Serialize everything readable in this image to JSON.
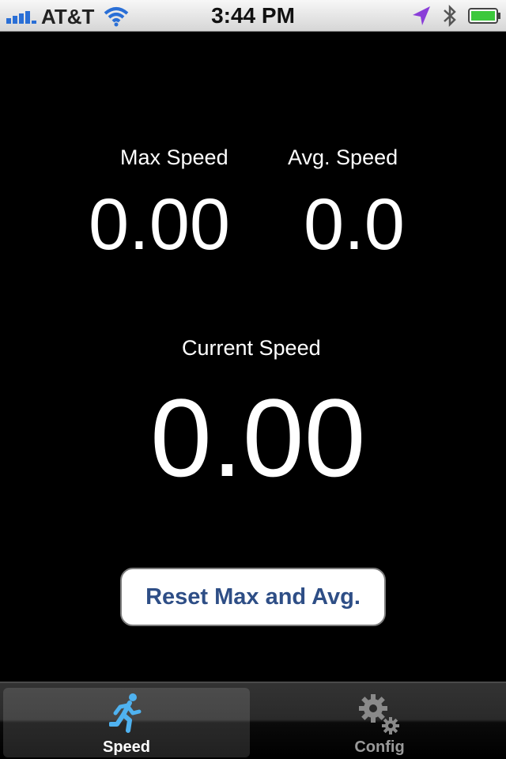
{
  "status_bar": {
    "carrier": "AT&T",
    "time": "3:44 PM",
    "icons": [
      "signal-bars-icon",
      "wifi-icon",
      "location-arrow-icon",
      "bluetooth-icon",
      "battery-icon"
    ]
  },
  "speeds": {
    "max_label": "Max Speed",
    "max_value": "0.00",
    "avg_label": "Avg. Speed",
    "avg_value": "0.0",
    "current_label": "Current Speed",
    "current_value": "0.00"
  },
  "reset_button_label": "Reset Max and Avg.",
  "tabs": [
    {
      "label": "Speed",
      "icon": "running-man-icon",
      "selected": true
    },
    {
      "label": "Config",
      "icon": "gears-icon",
      "selected": false
    }
  ],
  "colors": {
    "background": "#000000",
    "button_text": "#2e4e86",
    "tab_icon_active": "#4fb2f0",
    "battery": "#3cc83c",
    "location": "#8a3ed8"
  }
}
